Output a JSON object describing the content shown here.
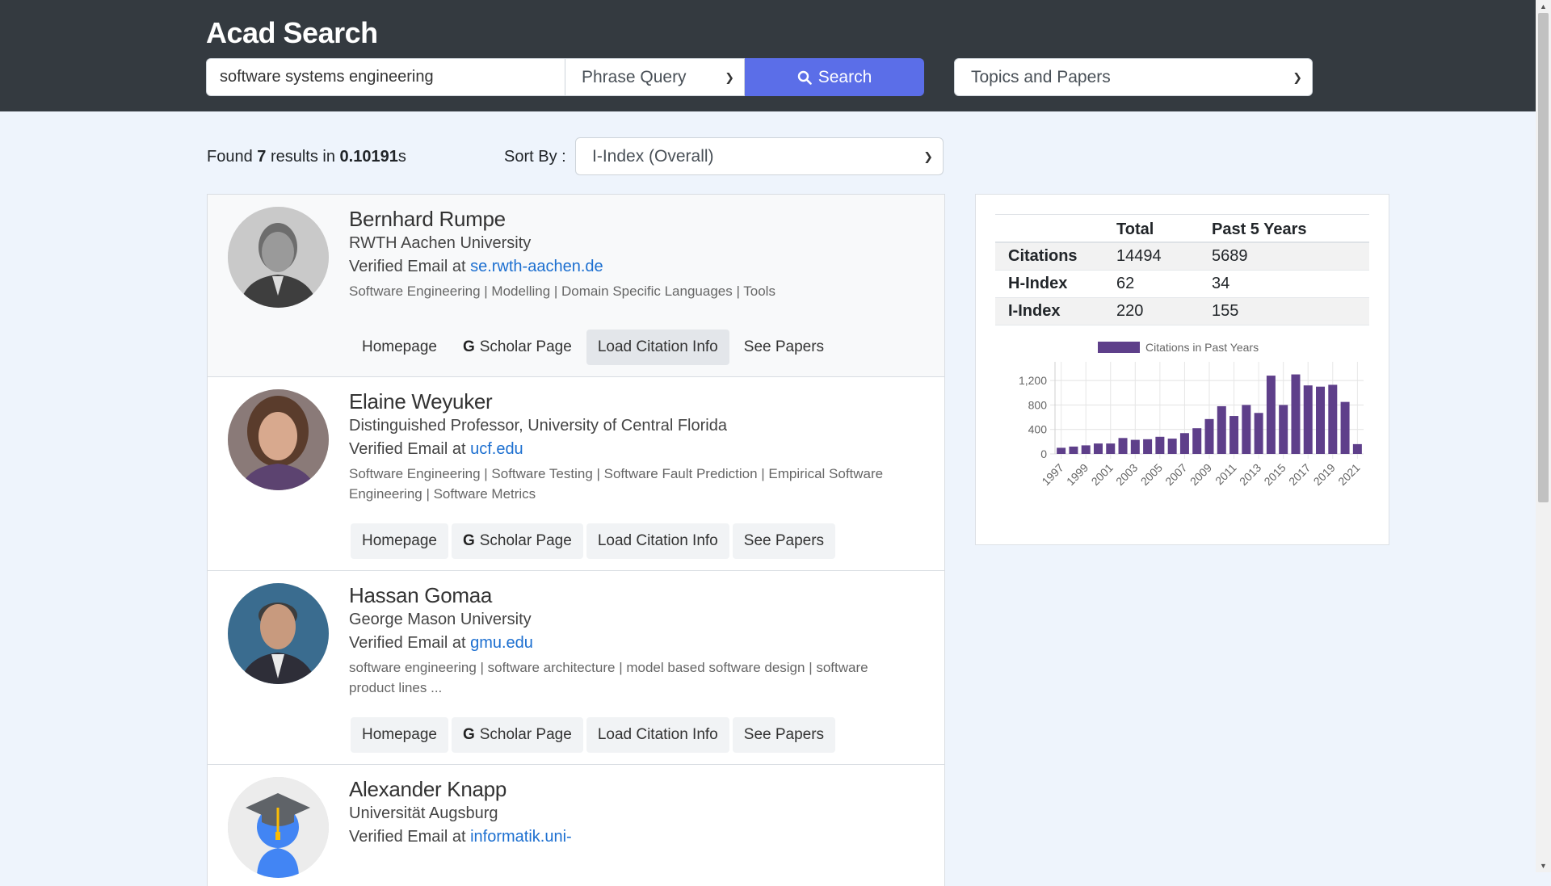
{
  "app": {
    "title": "Acad Search"
  },
  "search": {
    "query": "software systems engineering",
    "query_type": "Phrase Query",
    "button_label": "Search",
    "scope": "Topics and Papers"
  },
  "results": {
    "found_prefix": "Found ",
    "count": "7",
    "middle": " results in ",
    "time": "0.10191",
    "suffix": "s",
    "sort_label": "Sort By :",
    "sort_value": "I-Index (Overall)"
  },
  "actions": {
    "homepage": "Homepage",
    "scholar": "Scholar Page",
    "load": "Load Citation Info",
    "papers": "See Papers"
  },
  "authors": [
    {
      "name": "Bernhard Rumpe",
      "affiliation": "RWTH Aachen University",
      "email_prefix": "Verified Email at ",
      "email_domain": "se.rwth-aachen.de",
      "tags_line1": "Software Engineering | Modelling | Domain Specific Languages | Tools",
      "tags_line2": ""
    },
    {
      "name": "Elaine Weyuker",
      "affiliation": "Distinguished Professor, University of Central Florida",
      "email_prefix": "Verified Email at ",
      "email_domain": "ucf.edu",
      "tags_line1": "Software Engineering | Software Testing | Software Fault Prediction | Empirical Software",
      "tags_line2": "Engineering | Software Metrics"
    },
    {
      "name": "Hassan Gomaa",
      "affiliation": "George Mason University",
      "email_prefix": "Verified Email at ",
      "email_domain": "gmu.edu",
      "tags_line1": "software engineering | software architecture | model based software design | software",
      "tags_line2": "product lines ..."
    },
    {
      "name": "Alexander Knapp",
      "affiliation": "Universität Augsburg",
      "email_prefix": "Verified Email at ",
      "email_domain": "informatik.uni-"
    }
  ],
  "stats": {
    "headers": [
      "",
      "Total",
      "Past 5 Years"
    ],
    "rows": [
      {
        "label": "Citations",
        "total": "14494",
        "past5": "5689"
      },
      {
        "label": "H-Index",
        "total": "62",
        "past5": "34"
      },
      {
        "label": "I-Index",
        "total": "220",
        "past5": "155"
      }
    ]
  },
  "chart_data": {
    "type": "bar",
    "legend": "Citations in Past Years",
    "legend_position": "top",
    "color": "#5e3f8a",
    "grid": true,
    "ylim": [
      0,
      1400
    ],
    "yticks": [
      0,
      400,
      800,
      1200
    ],
    "ytick_labels": [
      "0",
      "400",
      "800",
      "1,200"
    ],
    "categories": [
      "1997",
      "1998",
      "1999",
      "2000",
      "2001",
      "2002",
      "2003",
      "2004",
      "2005",
      "2006",
      "2007",
      "2008",
      "2009",
      "2010",
      "2011",
      "2012",
      "2013",
      "2014",
      "2015",
      "2016",
      "2017",
      "2018",
      "2019",
      "2020",
      "2021"
    ],
    "xtick_labels": [
      "1997",
      "1999",
      "2001",
      "2003",
      "2005",
      "2007",
      "2009",
      "2011",
      "2013",
      "2015",
      "2017",
      "2019",
      "2021"
    ],
    "values": [
      100,
      120,
      140,
      170,
      170,
      260,
      230,
      240,
      280,
      250,
      340,
      420,
      570,
      780,
      620,
      800,
      670,
      1280,
      800,
      1300,
      1120,
      1100,
      1130,
      850,
      160
    ]
  }
}
